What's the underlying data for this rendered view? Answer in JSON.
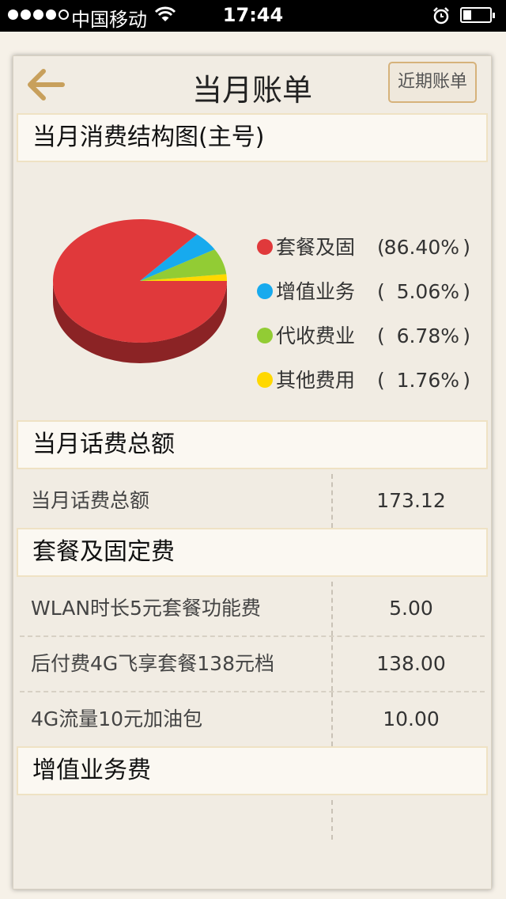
{
  "status_bar": {
    "carrier": "中国移动",
    "time": "17:44"
  },
  "header": {
    "title": "当月账单",
    "recent_bill_button": "近期账单"
  },
  "sections": {
    "structure": {
      "title": "当月消费结构图(主号)"
    },
    "total": {
      "title": "当月话费总额",
      "rows": [
        {
          "label": "当月话费总额",
          "value": "173.12"
        }
      ]
    },
    "package": {
      "title": "套餐及固定费",
      "rows": [
        {
          "label": "WLAN时长5元套餐功能费",
          "value": "5.00"
        },
        {
          "label": "后付费4G飞享套餐138元档",
          "value": "138.00"
        },
        {
          "label": "4G流量10元加油包",
          "value": "10.00"
        }
      ]
    },
    "value_added": {
      "title": "增值业务费"
    }
  },
  "chart_data": {
    "type": "pie",
    "labels": [
      "套餐及固",
      "增值业务",
      "代收费业",
      "其他费用"
    ],
    "values": [
      86.4,
      5.06,
      6.78,
      1.76
    ],
    "value_labels": [
      "86.40%",
      "5.06%",
      "6.78%",
      "1.76%"
    ],
    "colors": [
      "#e0393b",
      "#17aaee",
      "#92cc34",
      "#ffd800"
    ],
    "legend_position": "right"
  }
}
